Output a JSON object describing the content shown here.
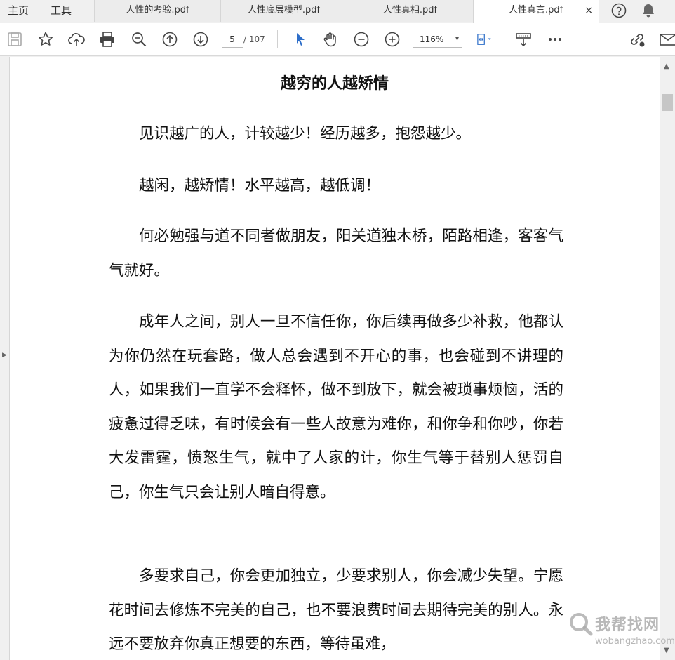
{
  "nav": {
    "home": "主页",
    "tools": "工具"
  },
  "tabs": [
    {
      "label": "人性的考验.pdf"
    },
    {
      "label": "人性底层模型.pdf"
    },
    {
      "label": "人性真相.pdf"
    },
    {
      "label": "人性真言.pdf",
      "active": true,
      "close": "×"
    }
  ],
  "toolbar": {
    "page_current": "5",
    "page_total": "/ 107",
    "zoom": "116%",
    "zoom_chevron": "▾"
  },
  "document": {
    "title": "越穷的人越矫情",
    "paragraphs": [
      "见识越广的人，计较越少！经历越多，抱怨越少。",
      "越闲，越矫情！水平越高，越低调！",
      "何必勉强与道不同者做朋友，阳关道独木桥，陌路相逢，客客气气就好。",
      "成年人之间，别人一旦不信任你，你后续再做多少补救，他都认为你仍然在玩套路，做人总会遇到不开心的事，也会碰到不讲理的人，如果我们一直学不会释怀，做不到放下，就会被琐事烦恼，活的疲惫过得乏味，有时候会有一些人故意为难你，和你争和你吵，你若大发雷霆，愤怒生气，就中了人家的计，你生气等于替别人惩罚自己，你生气只会让别人暗自得意。",
      "多要求自己，你会更加独立，少要求别人，你会减少失望。宁愿花时间去修炼不完美的自己，也不要浪费时间去期待完美的别人。永远不要放弃你真正想要的东西，等待虽难，"
    ]
  },
  "scrollbar": {
    "up": "▲",
    "down": "▼",
    "panel_arrow": "▶"
  },
  "watermark": {
    "main": "我帮找网",
    "sub": "wobangzhao.com"
  },
  "colors": {
    "accent_blue": "#2d6ec9",
    "icon_gray": "#444444"
  }
}
